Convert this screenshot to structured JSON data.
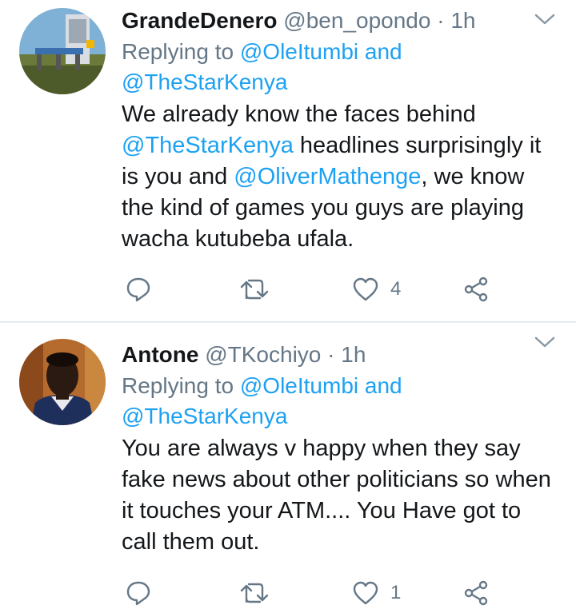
{
  "tweets": [
    {
      "name": "GrandeDenero",
      "handle": "@ben_opondo",
      "separator": "·",
      "time": "1h",
      "replying_prefix": "Replying to",
      "replying_to_1": "@OleItumbi",
      "replying_and": "and",
      "replying_to_2": "@TheStarKenya",
      "body": [
        {
          "t": "We  already know the faces behind ",
          "m": false
        },
        {
          "t": "@TheStarKenya",
          "m": true
        },
        {
          "t": " headlines surprisingly it is you and ",
          "m": false
        },
        {
          "t": "@OliverMathenge",
          "m": true
        },
        {
          "t": ", we know the kind of games you guys are playing wacha kutubeba ufala.",
          "m": false
        }
      ],
      "like_count": "4"
    },
    {
      "name": "Antone",
      "handle": "@TKochiyo",
      "separator": "·",
      "time": "1h",
      "replying_prefix": "Replying to",
      "replying_to_1": "@OleItumbi",
      "replying_and": "and",
      "replying_to_2": "@TheStarKenya",
      "body": [
        {
          "t": "You are always v happy when they say fake news about other politicians so when it touches your ATM.... You Have got to call them out.",
          "m": false
        }
      ],
      "like_count": "1"
    }
  ],
  "colors": {
    "text": "#14171a",
    "secondary": "#657786",
    "mention": "#1da1f2",
    "divider": "#e6ecf0"
  },
  "icons": [
    "reply-icon",
    "retweet-icon",
    "like-icon",
    "share-icon",
    "chevron-down-icon"
  ]
}
